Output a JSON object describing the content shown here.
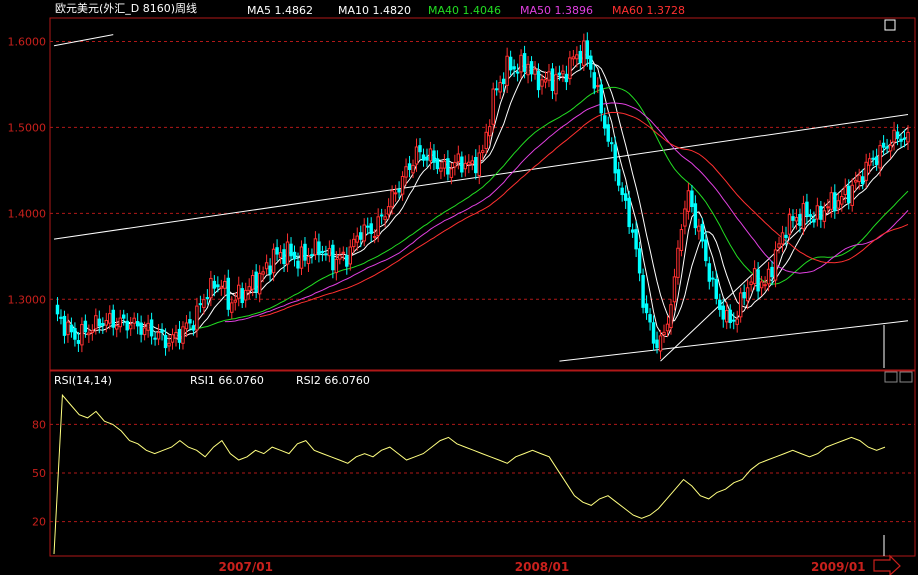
{
  "header": {
    "title": "欧元美元(外汇_D 8160)周线",
    "ma_readouts": [
      {
        "label": "MA5 1.4862",
        "color": "#ffffff"
      },
      {
        "label": "MA10 1.4820",
        "color": "#ffffff"
      },
      {
        "label": "MA40 1.4046",
        "color": "#22dd22"
      },
      {
        "label": "MA50 1.3896",
        "color": "#e040e0"
      },
      {
        "label": "MA60  1.3728",
        "color": "#ff3030"
      }
    ]
  },
  "rsi_header": {
    "label": "RSI(14,14)",
    "rsi1": "RSI1   66.0760",
    "rsi2": "RSI2   66.0760"
  },
  "colors": {
    "up_candle": "#ff3030",
    "down_candle": "#00ffff",
    "grid": "#b01818",
    "axis_text": "#c8201c",
    "trend_line": "#ffffff",
    "rsi_line": "#ffff80"
  },
  "chart_data": [
    {
      "type": "candlestick",
      "title": "欧元美元(外汇_D 8160)周线",
      "ylim": [
        1.22,
        1.625
      ],
      "yticks": [
        "1.6000",
        "1.5000",
        "1.4000",
        "1.3000"
      ],
      "xticks": [
        "2007/01",
        "2008/01",
        "2009/01"
      ],
      "grid": true,
      "close_path": [
        [
          0,
          1.285
        ],
        [
          6,
          1.255
        ],
        [
          14,
          1.275
        ],
        [
          22,
          1.272
        ],
        [
          28,
          1.262
        ],
        [
          33,
          1.25
        ],
        [
          40,
          1.275
        ],
        [
          44,
          1.31
        ],
        [
          48,
          1.32
        ],
        [
          50,
          1.295
        ],
        [
          55,
          1.31
        ],
        [
          60,
          1.33
        ],
        [
          63,
          1.35
        ],
        [
          67,
          1.355
        ],
        [
          70,
          1.345
        ],
        [
          76,
          1.36
        ],
        [
          80,
          1.345
        ],
        [
          84,
          1.35
        ],
        [
          88,
          1.38
        ],
        [
          92,
          1.38
        ],
        [
          96,
          1.41
        ],
        [
          100,
          1.44
        ],
        [
          104,
          1.47
        ],
        [
          108,
          1.465
        ],
        [
          112,
          1.45
        ],
        [
          116,
          1.46
        ],
        [
          120,
          1.455
        ],
        [
          123,
          1.47
        ],
        [
          126,
          1.535
        ],
        [
          130,
          1.57
        ],
        [
          134,
          1.57
        ],
        [
          136,
          1.575
        ],
        [
          138,
          1.555
        ],
        [
          142,
          1.555
        ],
        [
          146,
          1.56
        ],
        [
          149,
          1.58
        ],
        [
          152,
          1.59
        ],
        [
          154,
          1.57
        ],
        [
          157,
          1.52
        ],
        [
          160,
          1.47
        ],
        [
          163,
          1.42
        ],
        [
          166,
          1.38
        ],
        [
          169,
          1.3
        ],
        [
          172,
          1.25
        ],
        [
          175,
          1.255
        ],
        [
          178,
          1.32
        ],
        [
          180,
          1.39
        ],
        [
          182,
          1.42
        ],
        [
          185,
          1.38
        ],
        [
          188,
          1.33
        ],
        [
          190,
          1.3
        ],
        [
          193,
          1.275
        ],
        [
          196,
          1.28
        ],
        [
          198,
          1.31
        ],
        [
          201,
          1.325
        ],
        [
          204,
          1.315
        ],
        [
          206,
          1.34
        ],
        [
          210,
          1.385
        ],
        [
          213,
          1.395
        ],
        [
          216,
          1.4
        ],
        [
          219,
          1.395
        ],
        [
          222,
          1.41
        ],
        [
          225,
          1.415
        ],
        [
          228,
          1.425
        ],
        [
          231,
          1.44
        ],
        [
          234,
          1.46
        ],
        [
          237,
          1.47
        ],
        [
          240,
          1.485
        ],
        [
          243,
          1.49
        ],
        [
          245,
          1.485
        ]
      ],
      "series": [
        {
          "name": "MA5",
          "color": "#ffffff",
          "from": 0
        },
        {
          "name": "MA10",
          "color": "#ffffff",
          "from": 0
        },
        {
          "name": "MA40",
          "color": "#22dd22",
          "from": 39
        },
        {
          "name": "MA50",
          "color": "#e040e0",
          "from": 49
        },
        {
          "name": "MA60",
          "color": "#ff3030",
          "from": 59
        }
      ],
      "trend_lines": [
        [
          [
            0,
            1.37
          ],
          [
            245,
            1.515
          ]
        ],
        [
          [
            0,
            1.595
          ],
          [
            17,
            1.608
          ]
        ],
        [
          [
            145,
            1.228
          ],
          [
            245,
            1.275
          ]
        ],
        [
          [
            174,
            1.228
          ],
          [
            245,
            1.5
          ]
        ]
      ],
      "candle_count": 246
    },
    {
      "type": "line",
      "title": "RSI(14,14)",
      "ylim": [
        0,
        100
      ],
      "yticks": [
        "80",
        "50",
        "20"
      ],
      "grid": true,
      "series": [
        {
          "name": "RSI1",
          "color": "#ffff80",
          "values": [
            0,
            98,
            92,
            86,
            84,
            88,
            82,
            80,
            76,
            70,
            68,
            64,
            62,
            64,
            66,
            70,
            66,
            64,
            60,
            66,
            70,
            62,
            58,
            60,
            64,
            62,
            66,
            64,
            62,
            68,
            70,
            64,
            62,
            60,
            58,
            56,
            60,
            62,
            60,
            64,
            66,
            62,
            58,
            60,
            62,
            66,
            70,
            72,
            68,
            66,
            64,
            62,
            60,
            58,
            56,
            60,
            62,
            64,
            62,
            60,
            52,
            44,
            36,
            32,
            30,
            34,
            36,
            32,
            28,
            24,
            22,
            24,
            28,
            34,
            40,
            46,
            42,
            36,
            34,
            38,
            40,
            44,
            46,
            52,
            56,
            58,
            60,
            62,
            64,
            62,
            60,
            62,
            66,
            68,
            70,
            72,
            70,
            66,
            64,
            66
          ]
        }
      ]
    }
  ]
}
